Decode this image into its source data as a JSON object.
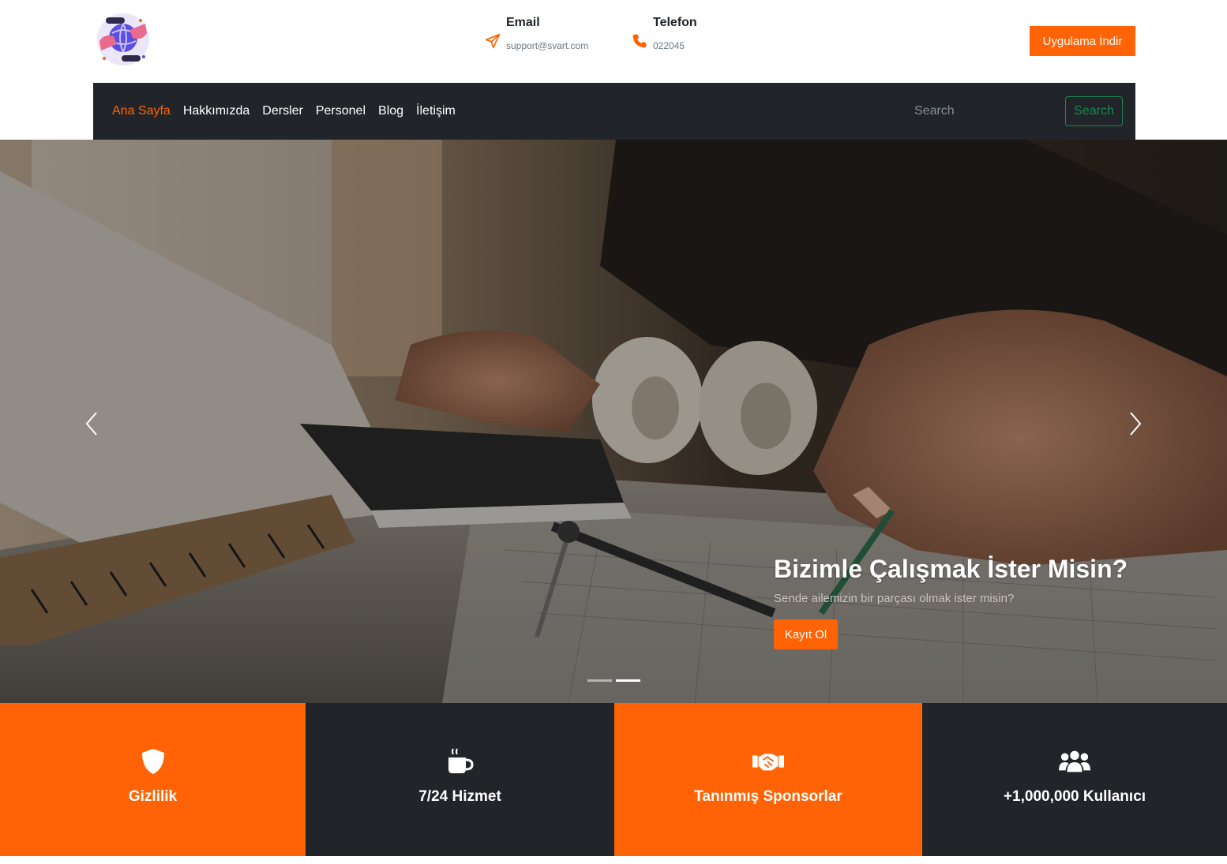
{
  "header": {
    "email": {
      "title": "Email",
      "value": "support@svart.com"
    },
    "phone": {
      "title": "Telefon",
      "value": "022045"
    },
    "download_label": "Uygulama İndir"
  },
  "navbar": {
    "links": [
      {
        "label": "Ana Sayfa",
        "active": true
      },
      {
        "label": "Hakkımızda"
      },
      {
        "label": "Dersler"
      },
      {
        "label": "Personel"
      },
      {
        "label": "Blog"
      },
      {
        "label": "İletişim"
      }
    ],
    "search_placeholder": "Search",
    "search_button": "Search"
  },
  "hero": {
    "title": "Bizimle Çalışmak İster Misin?",
    "subtitle": "Sende ailemizin bir parçası olmak ister misin?",
    "button": "Kayıt Ol",
    "indicators": [
      {
        "active": false
      },
      {
        "active": true
      }
    ]
  },
  "features": [
    {
      "label": "Gizlilik",
      "icon": "shield-icon",
      "color": "#ff6305"
    },
    {
      "label": "7/24 Hizmet",
      "icon": "coffee-cup-icon",
      "color": "#212529"
    },
    {
      "label": "Tanınmış Sponsorlar",
      "icon": "handshake-icon",
      "color": "#ff6305"
    },
    {
      "label": "+1,000,000 Kullanıcı",
      "icon": "users-icon",
      "color": "#212529"
    }
  ],
  "colors": {
    "accent": "#ff6305",
    "dark": "#212529",
    "search_green": "#198754"
  }
}
